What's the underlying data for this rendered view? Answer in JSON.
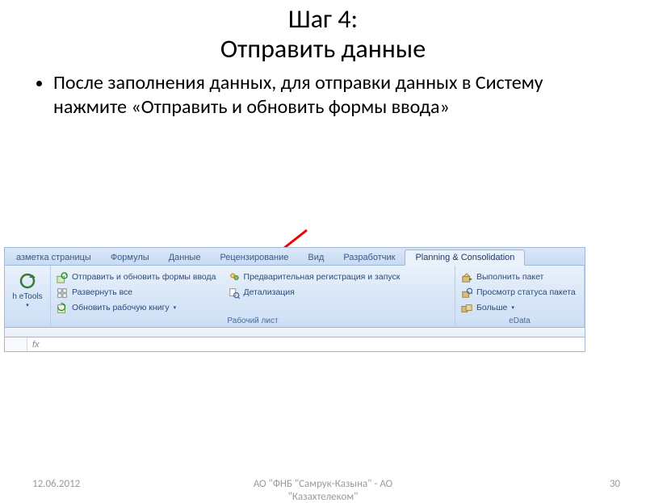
{
  "slide": {
    "title_line1": "Шаг 4:",
    "title_line2": "Отправить данные",
    "bullet": "После заполнения данных, для отправки данных в Систему нажмите «Отправить и обновить формы ввода»"
  },
  "ribbon": {
    "tabs": {
      "layout": "азметка страницы",
      "formulas": "Формулы",
      "data": "Данные",
      "review": "Рецензирование",
      "view": "Вид",
      "developer": "Разработчик",
      "planning": "Planning & Consolidation"
    },
    "group_etools": {
      "refresh_label": "h  eTools",
      "dd": "▾"
    },
    "group_worksheet": {
      "send_refresh": "Отправить и обновить формы ввода",
      "expand_all": "Развернуть все",
      "refresh_wb": "Обновить рабочую книгу",
      "prereg": "Предварительная регистрация и запуск",
      "detail": "Детализация",
      "label": "Рабочий лист"
    },
    "group_edata": {
      "run_pkg": "Выполнить пакет",
      "pkg_status": "Просмотр статуса пакета",
      "more": "Больше",
      "label": "eData"
    }
  },
  "fx_label": "fx",
  "footer": {
    "date": "12.06.2012",
    "org_line1": "АО \"ФНБ \"Самрук-Казына\" - АО",
    "org_line2": "\"Казахтелеком\"",
    "page": "30"
  }
}
